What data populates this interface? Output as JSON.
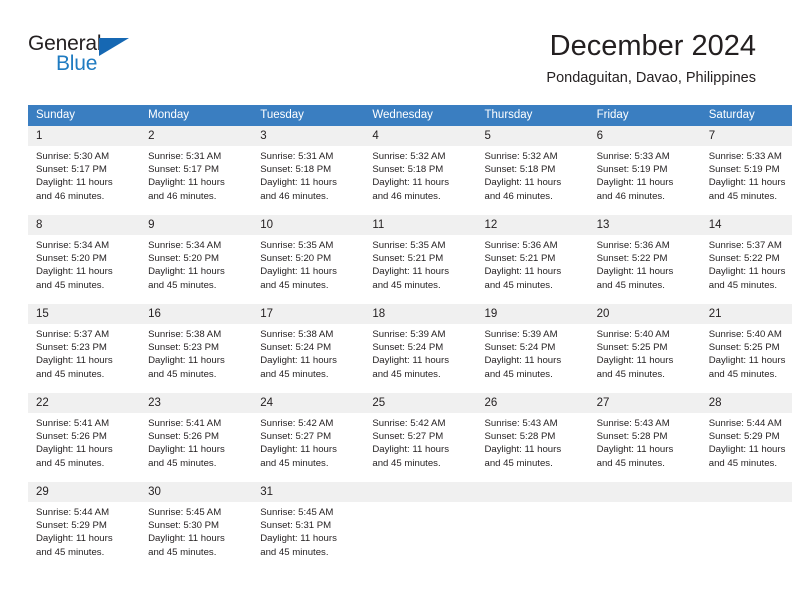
{
  "brand": {
    "line1": "General",
    "line2": "Blue",
    "triangle_color": "#1668b3",
    "blue_color": "#1f7bc1"
  },
  "header": {
    "title": "December 2024",
    "subtitle": "Pondaguitan, Davao, Philippines"
  },
  "calendar": {
    "header_bg": "#3a7ec1",
    "daynum_bg": "#f0f0f0",
    "separator_color": "#2a6cb0",
    "weekday_headers": [
      "Sunday",
      "Monday",
      "Tuesday",
      "Wednesday",
      "Thursday",
      "Friday",
      "Saturday"
    ],
    "weeks": [
      [
        {
          "day": "1",
          "sunrise": "Sunrise: 5:30 AM",
          "sunset": "Sunset: 5:17 PM",
          "daylight_line1": "Daylight: 11 hours",
          "daylight_line2": "and 46 minutes."
        },
        {
          "day": "2",
          "sunrise": "Sunrise: 5:31 AM",
          "sunset": "Sunset: 5:17 PM",
          "daylight_line1": "Daylight: 11 hours",
          "daylight_line2": "and 46 minutes."
        },
        {
          "day": "3",
          "sunrise": "Sunrise: 5:31 AM",
          "sunset": "Sunset: 5:18 PM",
          "daylight_line1": "Daylight: 11 hours",
          "daylight_line2": "and 46 minutes."
        },
        {
          "day": "4",
          "sunrise": "Sunrise: 5:32 AM",
          "sunset": "Sunset: 5:18 PM",
          "daylight_line1": "Daylight: 11 hours",
          "daylight_line2": "and 46 minutes."
        },
        {
          "day": "5",
          "sunrise": "Sunrise: 5:32 AM",
          "sunset": "Sunset: 5:18 PM",
          "daylight_line1": "Daylight: 11 hours",
          "daylight_line2": "and 46 minutes."
        },
        {
          "day": "6",
          "sunrise": "Sunrise: 5:33 AM",
          "sunset": "Sunset: 5:19 PM",
          "daylight_line1": "Daylight: 11 hours",
          "daylight_line2": "and 46 minutes."
        },
        {
          "day": "7",
          "sunrise": "Sunrise: 5:33 AM",
          "sunset": "Sunset: 5:19 PM",
          "daylight_line1": "Daylight: 11 hours",
          "daylight_line2": "and 45 minutes."
        }
      ],
      [
        {
          "day": "8",
          "sunrise": "Sunrise: 5:34 AM",
          "sunset": "Sunset: 5:20 PM",
          "daylight_line1": "Daylight: 11 hours",
          "daylight_line2": "and 45 minutes."
        },
        {
          "day": "9",
          "sunrise": "Sunrise: 5:34 AM",
          "sunset": "Sunset: 5:20 PM",
          "daylight_line1": "Daylight: 11 hours",
          "daylight_line2": "and 45 minutes."
        },
        {
          "day": "10",
          "sunrise": "Sunrise: 5:35 AM",
          "sunset": "Sunset: 5:20 PM",
          "daylight_line1": "Daylight: 11 hours",
          "daylight_line2": "and 45 minutes."
        },
        {
          "day": "11",
          "sunrise": "Sunrise: 5:35 AM",
          "sunset": "Sunset: 5:21 PM",
          "daylight_line1": "Daylight: 11 hours",
          "daylight_line2": "and 45 minutes."
        },
        {
          "day": "12",
          "sunrise": "Sunrise: 5:36 AM",
          "sunset": "Sunset: 5:21 PM",
          "daylight_line1": "Daylight: 11 hours",
          "daylight_line2": "and 45 minutes."
        },
        {
          "day": "13",
          "sunrise": "Sunrise: 5:36 AM",
          "sunset": "Sunset: 5:22 PM",
          "daylight_line1": "Daylight: 11 hours",
          "daylight_line2": "and 45 minutes."
        },
        {
          "day": "14",
          "sunrise": "Sunrise: 5:37 AM",
          "sunset": "Sunset: 5:22 PM",
          "daylight_line1": "Daylight: 11 hours",
          "daylight_line2": "and 45 minutes."
        }
      ],
      [
        {
          "day": "15",
          "sunrise": "Sunrise: 5:37 AM",
          "sunset": "Sunset: 5:23 PM",
          "daylight_line1": "Daylight: 11 hours",
          "daylight_line2": "and 45 minutes."
        },
        {
          "day": "16",
          "sunrise": "Sunrise: 5:38 AM",
          "sunset": "Sunset: 5:23 PM",
          "daylight_line1": "Daylight: 11 hours",
          "daylight_line2": "and 45 minutes."
        },
        {
          "day": "17",
          "sunrise": "Sunrise: 5:38 AM",
          "sunset": "Sunset: 5:24 PM",
          "daylight_line1": "Daylight: 11 hours",
          "daylight_line2": "and 45 minutes."
        },
        {
          "day": "18",
          "sunrise": "Sunrise: 5:39 AM",
          "sunset": "Sunset: 5:24 PM",
          "daylight_line1": "Daylight: 11 hours",
          "daylight_line2": "and 45 minutes."
        },
        {
          "day": "19",
          "sunrise": "Sunrise: 5:39 AM",
          "sunset": "Sunset: 5:24 PM",
          "daylight_line1": "Daylight: 11 hours",
          "daylight_line2": "and 45 minutes."
        },
        {
          "day": "20",
          "sunrise": "Sunrise: 5:40 AM",
          "sunset": "Sunset: 5:25 PM",
          "daylight_line1": "Daylight: 11 hours",
          "daylight_line2": "and 45 minutes."
        },
        {
          "day": "21",
          "sunrise": "Sunrise: 5:40 AM",
          "sunset": "Sunset: 5:25 PM",
          "daylight_line1": "Daylight: 11 hours",
          "daylight_line2": "and 45 minutes."
        }
      ],
      [
        {
          "day": "22",
          "sunrise": "Sunrise: 5:41 AM",
          "sunset": "Sunset: 5:26 PM",
          "daylight_line1": "Daylight: 11 hours",
          "daylight_line2": "and 45 minutes."
        },
        {
          "day": "23",
          "sunrise": "Sunrise: 5:41 AM",
          "sunset": "Sunset: 5:26 PM",
          "daylight_line1": "Daylight: 11 hours",
          "daylight_line2": "and 45 minutes."
        },
        {
          "day": "24",
          "sunrise": "Sunrise: 5:42 AM",
          "sunset": "Sunset: 5:27 PM",
          "daylight_line1": "Daylight: 11 hours",
          "daylight_line2": "and 45 minutes."
        },
        {
          "day": "25",
          "sunrise": "Sunrise: 5:42 AM",
          "sunset": "Sunset: 5:27 PM",
          "daylight_line1": "Daylight: 11 hours",
          "daylight_line2": "and 45 minutes."
        },
        {
          "day": "26",
          "sunrise": "Sunrise: 5:43 AM",
          "sunset": "Sunset: 5:28 PM",
          "daylight_line1": "Daylight: 11 hours",
          "daylight_line2": "and 45 minutes."
        },
        {
          "day": "27",
          "sunrise": "Sunrise: 5:43 AM",
          "sunset": "Sunset: 5:28 PM",
          "daylight_line1": "Daylight: 11 hours",
          "daylight_line2": "and 45 minutes."
        },
        {
          "day": "28",
          "sunrise": "Sunrise: 5:44 AM",
          "sunset": "Sunset: 5:29 PM",
          "daylight_line1": "Daylight: 11 hours",
          "daylight_line2": "and 45 minutes."
        }
      ],
      [
        {
          "day": "29",
          "sunrise": "Sunrise: 5:44 AM",
          "sunset": "Sunset: 5:29 PM",
          "daylight_line1": "Daylight: 11 hours",
          "daylight_line2": "and 45 minutes."
        },
        {
          "day": "30",
          "sunrise": "Sunrise: 5:45 AM",
          "sunset": "Sunset: 5:30 PM",
          "daylight_line1": "Daylight: 11 hours",
          "daylight_line2": "and 45 minutes."
        },
        {
          "day": "31",
          "sunrise": "Sunrise: 5:45 AM",
          "sunset": "Sunset: 5:31 PM",
          "daylight_line1": "Daylight: 11 hours",
          "daylight_line2": "and 45 minutes."
        },
        {
          "day": "",
          "sunrise": "",
          "sunset": "",
          "daylight_line1": "",
          "daylight_line2": ""
        },
        {
          "day": "",
          "sunrise": "",
          "sunset": "",
          "daylight_line1": "",
          "daylight_line2": ""
        },
        {
          "day": "",
          "sunrise": "",
          "sunset": "",
          "daylight_line1": "",
          "daylight_line2": ""
        },
        {
          "day": "",
          "sunrise": "",
          "sunset": "",
          "daylight_line1": "",
          "daylight_line2": ""
        }
      ]
    ]
  }
}
